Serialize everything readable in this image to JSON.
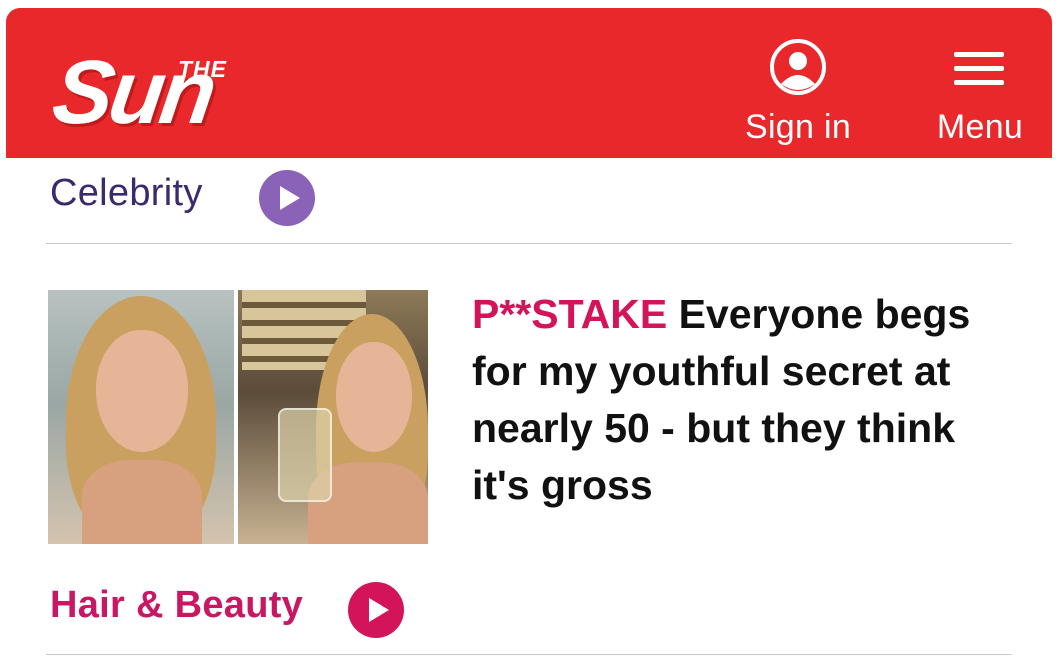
{
  "header": {
    "logo": {
      "the": "THE",
      "sun": "Sun"
    },
    "sign_in_label": "Sign in",
    "menu_label": "Menu",
    "bg_color": "#e8282b"
  },
  "sections": [
    {
      "label": "Celebrity",
      "color": "#3b2a6e",
      "play_color": "#8a63b8"
    },
    {
      "label": "Hair & Beauty",
      "color": "#c81764",
      "play_color": "#d4145a"
    }
  ],
  "article": {
    "kicker": "P**STAKE",
    "headline": "Everyone begs for my youthful secret at nearly 50 - but they think it's gross",
    "kicker_color": "#d4145a"
  },
  "icons": {
    "account": "user-circle-icon",
    "menu": "hamburger-icon",
    "play": "play-icon"
  }
}
